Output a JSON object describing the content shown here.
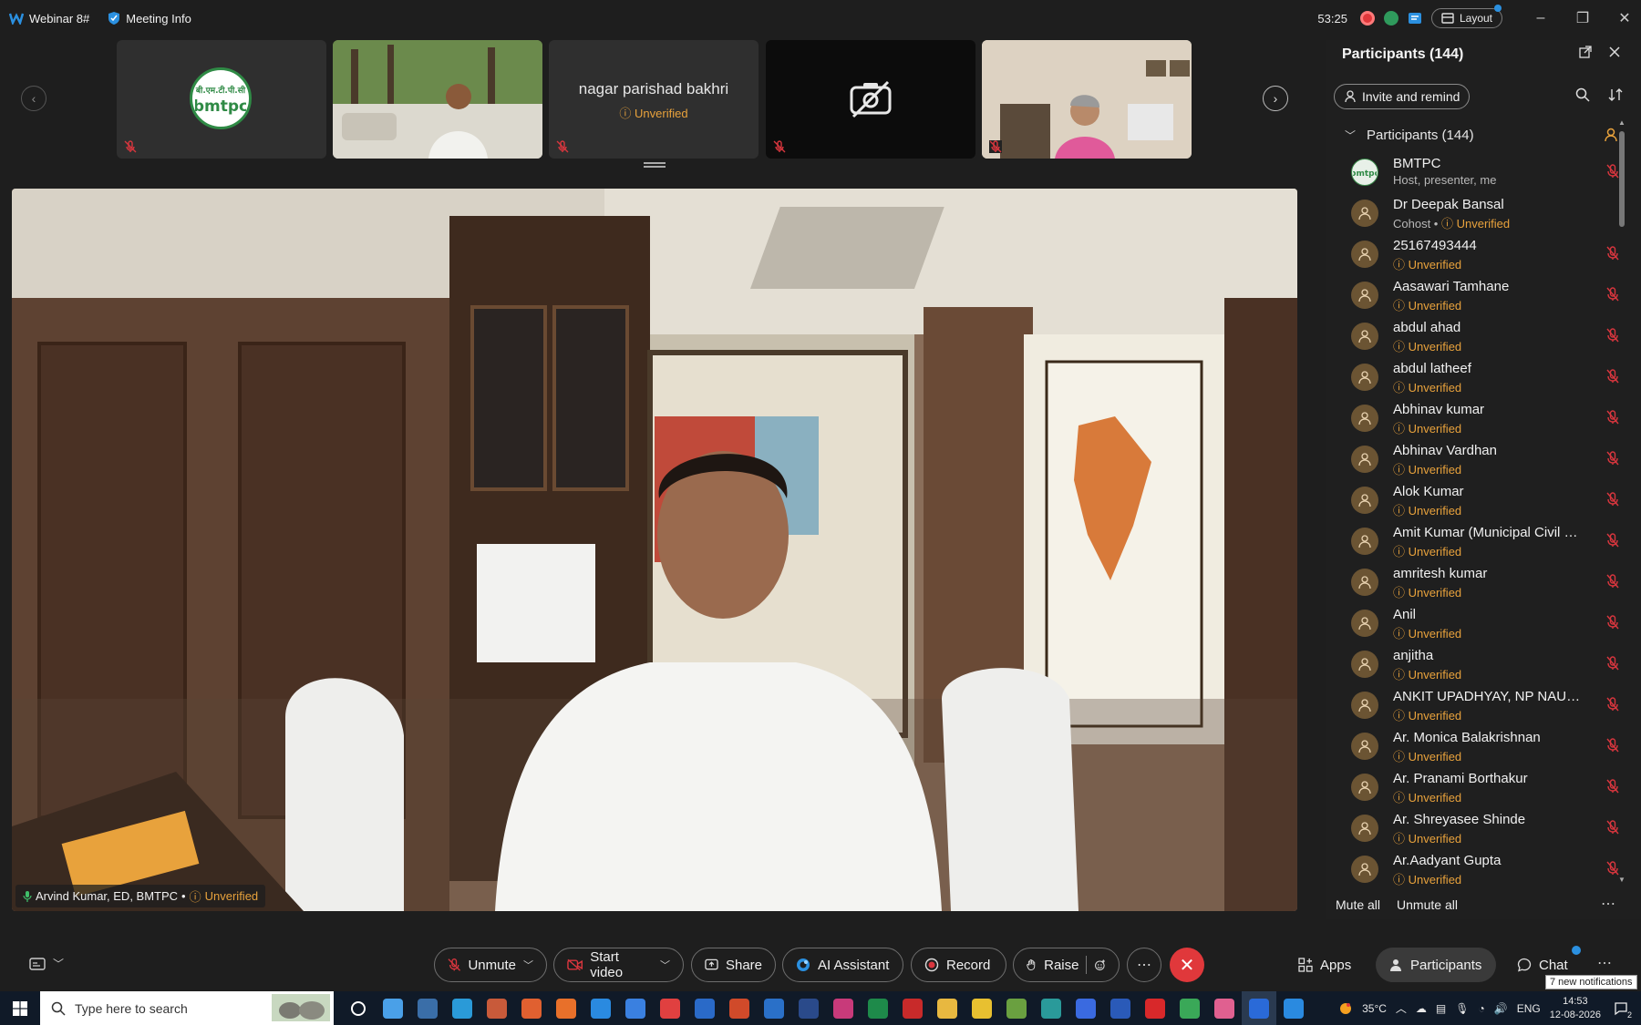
{
  "titlebar": {
    "app_title": "Webinar 8#",
    "meeting_info": "Meeting Info",
    "timer": "53:25",
    "layout_label": "Layout"
  },
  "thumbnails": {
    "text_tile_name": "nagar parishad bakhri",
    "text_tile_status": "Unverified",
    "logo_text": "बीएमटीपीसी bmtpc"
  },
  "main_video": {
    "speaker_name": "Arvind Kumar, ED, BMTPC",
    "separator": "•",
    "speaker_status": "Unverified"
  },
  "panel": {
    "title": "Participants (144)",
    "invite_label": "Invite and remind",
    "group_label": "Participants (144)",
    "participants": [
      {
        "name": "BMTPC",
        "sub": "Host, presenter, me",
        "sub_grey": true,
        "avatar": "bmtpc-logo"
      },
      {
        "name": "Dr Deepak Bansal",
        "sub_prefix": "Cohost • ",
        "sub": "Unverified",
        "avatar": "person"
      },
      {
        "name": "25167493444",
        "sub": "Unverified",
        "avatar": "person"
      },
      {
        "name": "Aasawari Tamhane",
        "sub": "Unverified",
        "avatar": "person"
      },
      {
        "name": "abdul ahad",
        "sub": "Unverified",
        "avatar": "person"
      },
      {
        "name": "abdul latheef",
        "sub": "Unverified",
        "avatar": "person"
      },
      {
        "name": "Abhinav kumar",
        "sub": "Unverified",
        "avatar": "person"
      },
      {
        "name": "Abhinav Vardhan",
        "sub": "Unverified",
        "avatar": "person"
      },
      {
        "name": "Alok Kumar",
        "sub": "Unverified",
        "avatar": "person"
      },
      {
        "name": "Amit Kumar (Municipal Civil E...",
        "sub": "Unverified",
        "avatar": "person"
      },
      {
        "name": "amritesh kumar",
        "sub": "Unverified",
        "avatar": "person"
      },
      {
        "name": "Anil",
        "sub": "Unverified",
        "avatar": "person"
      },
      {
        "name": "anjitha",
        "sub": "Unverified",
        "avatar": "person"
      },
      {
        "name": "ANKIT UPADHYAY, NP NAUBA...",
        "sub": "Unverified",
        "avatar": "person"
      },
      {
        "name": "Ar. Monica Balakrishnan",
        "sub": "Unverified",
        "avatar": "person"
      },
      {
        "name": "Ar. Pranami Borthakur",
        "sub": "Unverified",
        "avatar": "person"
      },
      {
        "name": "Ar. Shreyasee Shinde",
        "sub": "Unverified",
        "avatar": "person"
      },
      {
        "name": "Ar.Aadyant Gupta",
        "sub": "Unverified",
        "avatar": "person"
      }
    ],
    "mute_all": "Mute all",
    "unmute_all": "Unmute all"
  },
  "toolbar": {
    "unmute": "Unmute",
    "start_video": "Start video",
    "share": "Share",
    "ai_assistant": "AI Assistant",
    "record": "Record",
    "raise": "Raise",
    "apps": "Apps",
    "participants": "Participants",
    "chat": "Chat",
    "notification_tip": "7 new notifications"
  },
  "taskbar": {
    "search_placeholder": "Type here to search",
    "temperature": "35°C",
    "language": "ENG",
    "time": "14:53",
    "date": "12-08-2026",
    "notification_count": "2"
  },
  "colors": {
    "accent_orange": "#e8a23c",
    "end_red": "#e0383b",
    "mic_red": "#d9363e",
    "notify_blue": "#2b90e0"
  }
}
